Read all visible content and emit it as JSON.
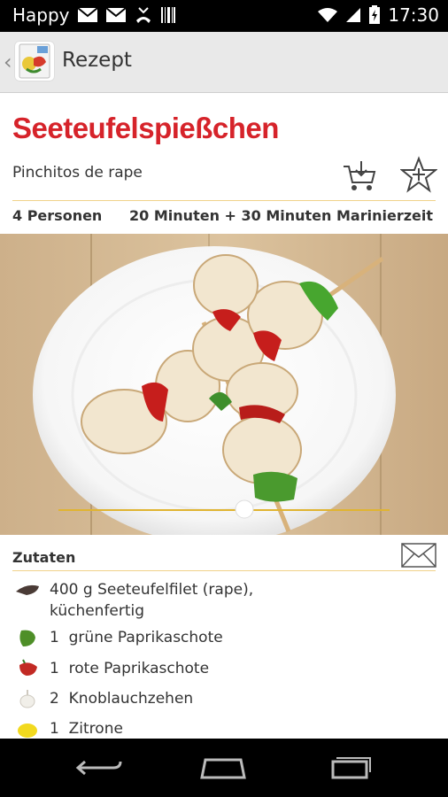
{
  "status": {
    "carrier": "Happy",
    "time": "17:30"
  },
  "actionbar": {
    "title": "Rezept"
  },
  "recipe": {
    "title": "Seeteufelspießchen",
    "subtitle": "Pinchitos de rape",
    "servings": "4 Personen",
    "time": "20 Minuten + 30 Minuten Marinierzeit"
  },
  "ingredients": {
    "header": "Zutaten",
    "items": [
      {
        "icon": "fish-fillet-icon",
        "amount": "400 g",
        "text": "Seeteufelfilet (rape),",
        "text2": "küchenfertig"
      },
      {
        "icon": "green-pepper-icon",
        "amount": "1",
        "text": "grüne Paprikaschote"
      },
      {
        "icon": "red-pepper-icon",
        "amount": "1",
        "text": "rote Paprikaschote"
      },
      {
        "icon": "garlic-icon",
        "amount": "2",
        "text": "Knoblauchzehen"
      },
      {
        "icon": "lemon-icon",
        "amount": "1",
        "text": "Zitrone"
      }
    ]
  },
  "colors": {
    "title": "#d6232a",
    "accent_line": "#f0d28a",
    "slider": "#e0b431"
  }
}
